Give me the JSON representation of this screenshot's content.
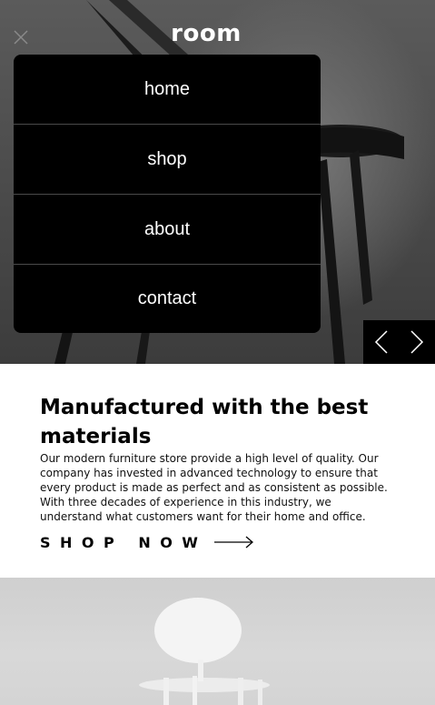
{
  "header": {
    "logo": "room",
    "close_icon": "close-icon"
  },
  "menu": {
    "items": [
      {
        "label": "home"
      },
      {
        "label": "shop"
      },
      {
        "label": "about"
      },
      {
        "label": "contact"
      }
    ]
  },
  "slider": {
    "prev_icon": "chevron-left-icon",
    "next_icon": "chevron-right-icon"
  },
  "feature": {
    "headline": "Manufactured with the best materials",
    "description": "Our modern furniture store provide a high level of quality. Our company has invested in advanced technology to ensure that every product is made as perfect and as consistent as possible. With three decades of experience in this industry, we understand what customers want for their home and office.",
    "cta_label": "SHOP NOW",
    "cta_icon": "arrow-right-icon"
  },
  "colors": {
    "menu_bg": "#000000",
    "text_primary": "#000000",
    "text_inverse": "#ffffff"
  }
}
